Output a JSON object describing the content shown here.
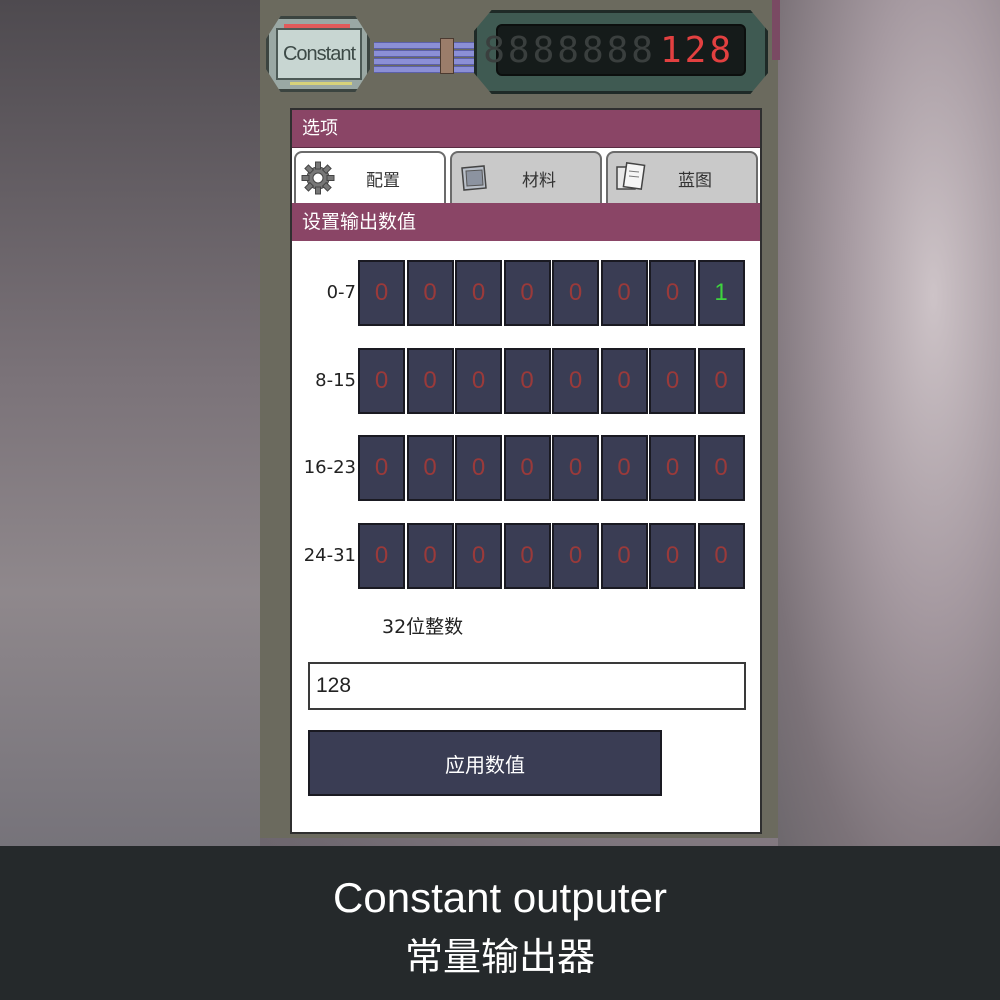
{
  "device": {
    "badge_label": "Constant",
    "display_ghost": "8888888",
    "display_value": "128"
  },
  "panel": {
    "title": "选项",
    "tabs": [
      {
        "label": "配置",
        "icon": "gear-icon",
        "active": true
      },
      {
        "label": "材料",
        "icon": "material-icon",
        "active": false
      },
      {
        "label": "蓝图",
        "icon": "blueprint-icon",
        "active": false
      }
    ],
    "section_title": "设置输出数值",
    "rows": [
      {
        "label": "0-7",
        "bits": [
          "0",
          "0",
          "0",
          "0",
          "0",
          "0",
          "0",
          "1"
        ]
      },
      {
        "label": "8-15",
        "bits": [
          "0",
          "0",
          "0",
          "0",
          "0",
          "0",
          "0",
          "0"
        ]
      },
      {
        "label": "16-23",
        "bits": [
          "0",
          "0",
          "0",
          "0",
          "0",
          "0",
          "0",
          "0"
        ]
      },
      {
        "label": "24-31",
        "bits": [
          "0",
          "0",
          "0",
          "0",
          "0",
          "0",
          "0",
          "0"
        ]
      }
    ],
    "int_label": "32位整数",
    "int_value": "128",
    "apply_label": "应用数值"
  },
  "caption": {
    "english": "Constant outputer",
    "chinese": "常量输出器"
  },
  "colors": {
    "header": "#8a4566",
    "bit_bg": "#3a3d54",
    "bit_off": "#9a3a3a",
    "bit_on": "#3ed43e",
    "display_digit": "#e24040"
  }
}
